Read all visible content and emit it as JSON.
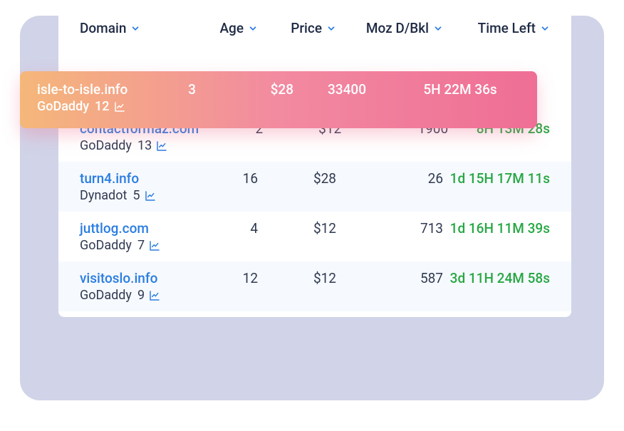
{
  "columns": {
    "domain": "Domain",
    "age": "Age",
    "price": "Price",
    "moz": "Moz D/Bkl",
    "time": "Time Left"
  },
  "hero": {
    "domain": "isle-to-isle.info",
    "registrar": "GoDaddy",
    "backlinks": "12",
    "age": "3",
    "price": "$28",
    "moz": "33400",
    "time": "5H 22M 36s"
  },
  "rows": [
    {
      "domain": "contactformaz.com",
      "registrar": "GoDaddy",
      "backlinks": "13",
      "age": "2",
      "price": "$12",
      "moz": "1900",
      "time": "8H 13M 28s",
      "alt": false
    },
    {
      "domain": "turn4.info",
      "registrar": "Dynadot",
      "backlinks": "5",
      "age": "16",
      "price": "$28",
      "moz": "26",
      "time": "1d 15H 17M 11s",
      "alt": true
    },
    {
      "domain": "juttlog.com",
      "registrar": "GoDaddy",
      "backlinks": "7",
      "age": "4",
      "price": "$12",
      "moz": "713",
      "time": "1d 16H 11M 39s",
      "alt": false
    },
    {
      "domain": "visitoslo.info",
      "registrar": "GoDaddy",
      "backlinks": "9",
      "age": "12",
      "price": "$12",
      "moz": "587",
      "time": "3d 11H 24M 58s",
      "alt": true
    }
  ]
}
